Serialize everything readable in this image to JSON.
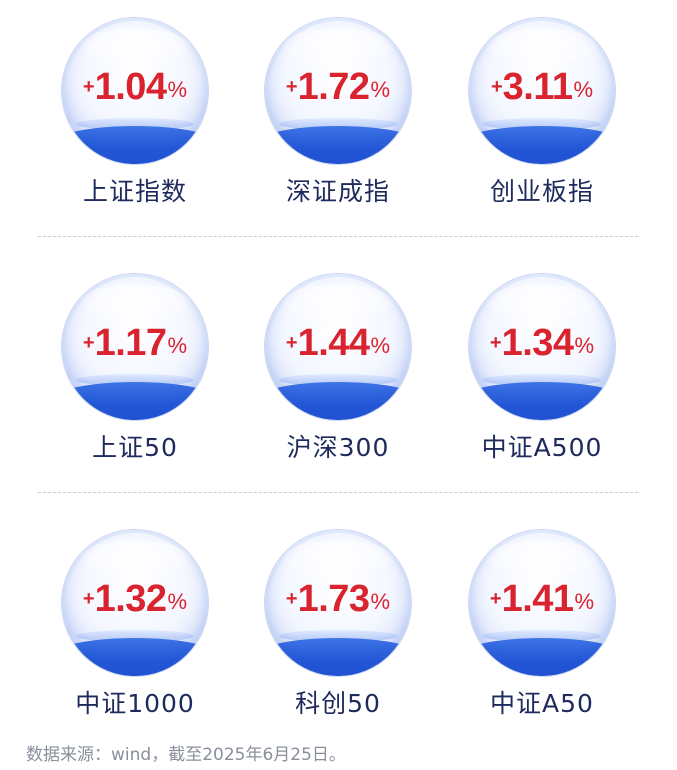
{
  "rows": [
    {
      "items": [
        {
          "sign": "+",
          "value": "1.04",
          "pct": "%",
          "label": "上证指数"
        },
        {
          "sign": "+",
          "value": "1.72",
          "pct": "%",
          "label": "深证成指"
        },
        {
          "sign": "+",
          "value": "3.11",
          "pct": "%",
          "label": "创业板指"
        }
      ]
    },
    {
      "items": [
        {
          "sign": "+",
          "value": "1.17",
          "pct": "%",
          "label": "上证50"
        },
        {
          "sign": "+",
          "value": "1.44",
          "pct": "%",
          "label": "沪深300"
        },
        {
          "sign": "+",
          "value": "1.34",
          "pct": "%",
          "label": "中证A500"
        }
      ]
    },
    {
      "items": [
        {
          "sign": "+",
          "value": "1.32",
          "pct": "%",
          "label": "中证1000"
        },
        {
          "sign": "+",
          "value": "1.73",
          "pct": "%",
          "label": "科创50"
        },
        {
          "sign": "+",
          "value": "1.41",
          "pct": "%",
          "label": "中证A50"
        }
      ]
    }
  ],
  "footnote": "数据来源：wind，截至2025年6月25日。",
  "colors": {
    "gain_red": "#d9232e",
    "label_navy": "#1f2a5c",
    "water_blue": "#2356d6"
  }
}
